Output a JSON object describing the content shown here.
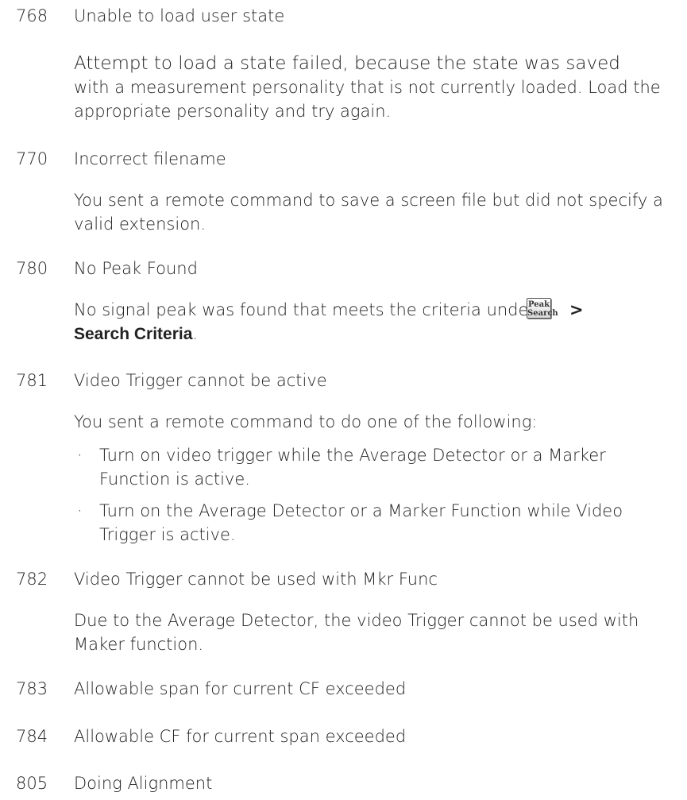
{
  "entries": [
    {
      "code": "768",
      "title": "Unable to load user state",
      "desc_line1": "Attempt to load a state failed, because the state was saved",
      "desc_rest": "with a measurement personality that is not currently loaded. Load the appropriate personality and try again."
    },
    {
      "code": "770",
      "title": "Incorrect filename",
      "desc": "You sent a remote command to save a screen file but did not specify a valid extension."
    },
    {
      "code": "780",
      "title": "No Peak Found",
      "desc_prefix": "No signal peak was found that meets the criteria under",
      "key_label_line1": "Peak",
      "key_label_line2": "Search",
      "gt": ">",
      "bold_text": "Search Criteria",
      "suffix": "."
    },
    {
      "code": "781",
      "title": "Video Trigger cannot be active",
      "desc": "You sent a remote command to do one of the following:",
      "bullet_symbol": "·",
      "bullets": [
        "Turn on video trigger while the Average Detector or a Marker Function is active.",
        "Turn on the Average Detector or a Marker Function while Video Trigger is active."
      ]
    },
    {
      "code": "782",
      "title": "Video Trigger cannot be used with Mkr Func",
      "desc": "Due to the Average Detector, the video Trigger cannot be used with Maker function."
    },
    {
      "code": "783",
      "title": "Allowable span for current CF exceeded"
    },
    {
      "code": "784",
      "title": "Allowable CF for current span exceeded"
    },
    {
      "code": "805",
      "title": "Doing Alignment"
    }
  ]
}
